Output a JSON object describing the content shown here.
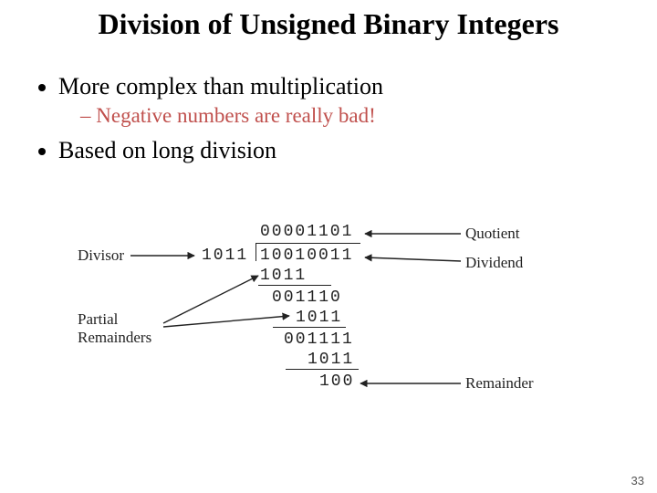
{
  "title": "Division of Unsigned Binary Integers",
  "bullets": {
    "b1": "More complex than multiplication",
    "b1s1": "Negative numbers are really bad!",
    "b2": "Based on long division"
  },
  "labels": {
    "quotient": "Quotient",
    "divisor": "Divisor",
    "dividend": "Dividend",
    "partial": "Partial\nRemainders",
    "remainder": "Remainder"
  },
  "division": {
    "quotient": "00001101",
    "divisor": "1011",
    "dividend": "10010011",
    "r1": "1011",
    "r2": "001110",
    "r3": "1011",
    "r4": "001111",
    "r5": "1011",
    "remainder": "100"
  },
  "page": "33"
}
